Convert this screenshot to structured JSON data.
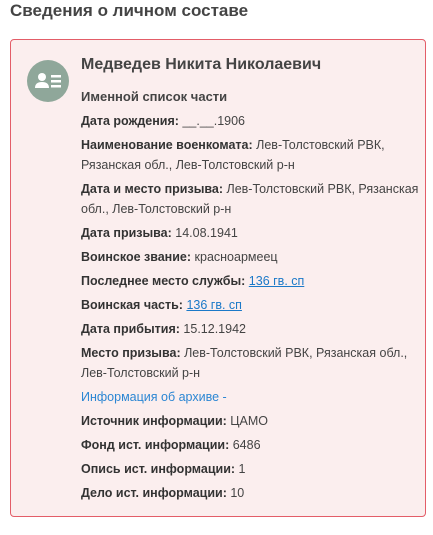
{
  "section": {
    "title": "Сведения о личном составе"
  },
  "person": {
    "name": "Медведев Никита Николаевич",
    "list_title": "Именной список части",
    "fields": {
      "birth_date": {
        "label": "Дата рождения:",
        "value": "__.__.1906"
      },
      "enlistment_office": {
        "label": "Наименование военкомата:",
        "value": "Лев-Толстовский РВК, Рязанская обл., Лев-Толстовский р-н"
      },
      "enlistment_date_place": {
        "label": "Дата и место призыва:",
        "value": "Лев-Толстовский РВК, Рязанская обл., Лев-Толстовский р-н"
      },
      "enlistment_date": {
        "label": "Дата призыва:",
        "value": "14.08.1941"
      },
      "rank": {
        "label": "Воинское звание:",
        "value": "красноармеец"
      },
      "last_service": {
        "label": "Последнее место службы:",
        "value": "136 гв. сп"
      },
      "unit": {
        "label": "Воинская часть:",
        "value": "136 гв. сп"
      },
      "arrival_date": {
        "label": "Дата прибытия:",
        "value": "15.12.1942"
      },
      "enlistment_place": {
        "label": "Место призыва:",
        "value": "Лев-Толстовский РВК, Рязанская обл., Лев-Толстовский р-н"
      }
    },
    "archive_link": "Информация об архиве -",
    "archive": {
      "source": {
        "label": "Источник информации:",
        "value": "ЦАМО"
      },
      "fond": {
        "label": "Фонд ист. информации:",
        "value": "6486"
      },
      "opis": {
        "label": "Опись ист. информации:",
        "value": "1"
      },
      "delo": {
        "label": "Дело ист. информации:",
        "value": "10"
      }
    }
  },
  "colors": {
    "card_background": "#fbeeee",
    "card_border": "#e35d68",
    "avatar": "#8fa79a",
    "link": "#1b79c8"
  },
  "icons": {
    "avatar": "person-id-card-icon"
  }
}
